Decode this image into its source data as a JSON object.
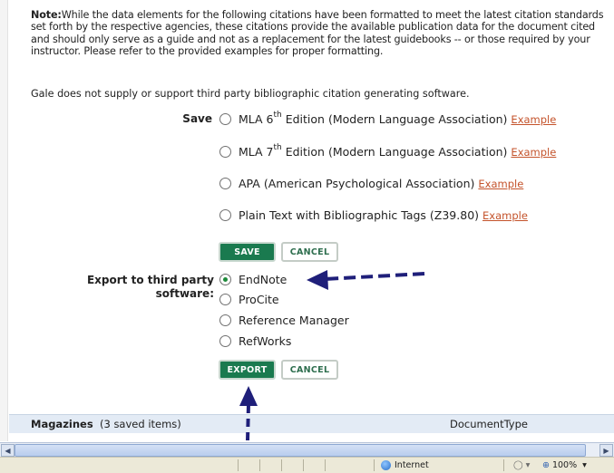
{
  "note": {
    "label": "Note:",
    "text": "While the data elements for the following citations have been formatted to meet the latest citation standards set forth by the respective agencies, these citations provide the available publication data for the document cited and should only serve as a guide and not as a replacement for the latest guidebooks -- or those required by your instructor. Please refer to the provided examples for proper formatting."
  },
  "gale_notice": "Gale does not supply or support third party bibliographic citation generating software.",
  "save": {
    "label": "Save",
    "options": [
      {
        "pre": "MLA 6",
        "sup": "th",
        "post": " Edition (Modern Language Association)",
        "example": "Example"
      },
      {
        "pre": "MLA 7",
        "sup": "th",
        "post": " Edition (Modern Language Association)",
        "example": "Example"
      },
      {
        "pre": "APA (American Psychological Association)",
        "example": "Example"
      },
      {
        "pre": "Plain Text with Bibliographic Tags (Z39.80)",
        "example": "Example"
      }
    ],
    "save_button": "SAVE",
    "cancel_button": "CANCEL"
  },
  "export": {
    "label": "Export to third party software:",
    "options": [
      "EndNote",
      "ProCite",
      "Reference Manager",
      "RefWorks"
    ],
    "selected": "EndNote",
    "export_button": "EXPORT",
    "cancel_button": "CANCEL"
  },
  "magazines_bar": {
    "title": "Magazines",
    "count": "(3  saved items)",
    "column": "DocumentType"
  },
  "status_bar": {
    "zone": "Internet",
    "zoom": "100%"
  },
  "colors": {
    "accent_green": "#1a7a4f",
    "link": "#c4532b",
    "annotation_arrow": "#1f1f7a"
  }
}
